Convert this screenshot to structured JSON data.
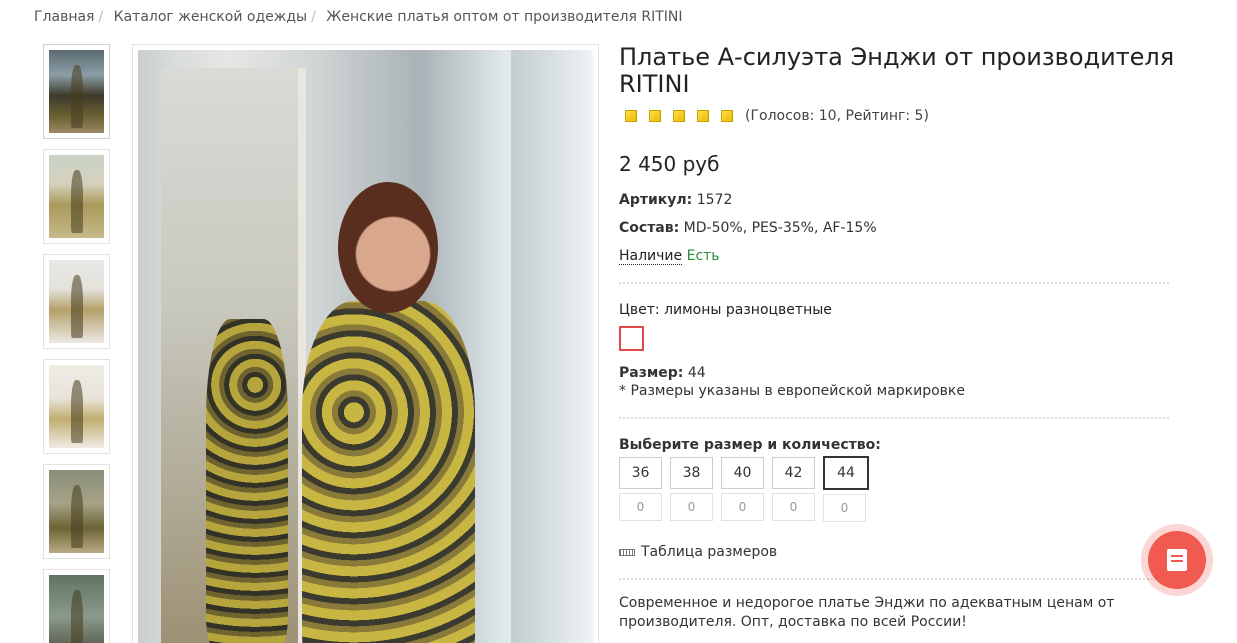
{
  "breadcrumb": {
    "items": [
      "Главная",
      "Каталог женской одежды",
      "Женские платья оптом от производителя RITINI"
    ],
    "separator": "/"
  },
  "gallery": {
    "thumb_icons": [
      "dress-photo-thumb-1",
      "dress-photo-thumb-2",
      "dress-photo-thumb-3",
      "dress-photo-thumb-4",
      "dress-photo-thumb-5",
      "dress-photo-thumb-6"
    ]
  },
  "product": {
    "title": "Платье А-силуэта Энджи от производителя RITINI",
    "rating": {
      "stars": 5,
      "text": "(Голосов: 10, Рейтинг: 5)"
    },
    "price": "2 450 руб",
    "article_label": "Артикул:",
    "article_value": "1572",
    "composition_label": "Состав:",
    "composition_value": "MD-50%, PES-35%, AF-15%",
    "availability_label": "Наличие",
    "availability_value": "Есть",
    "color_label": "Цвет:",
    "color_value": "лимоны разноцветные",
    "size_label": "Размер:",
    "size_value": "44",
    "size_note": "* Размеры указаны в европейской маркировке",
    "choose_label": "Выберите размер и количество:",
    "sizes": [
      {
        "size": "36",
        "qty": "0"
      },
      {
        "size": "38",
        "qty": "0"
      },
      {
        "size": "40",
        "qty": "0"
      },
      {
        "size": "42",
        "qty": "0"
      },
      {
        "size": "44",
        "qty": "0"
      }
    ],
    "selected_size": "44",
    "size_table_label": "Таблица размеров",
    "description": "Современное и недорогое платье Энджи по адекватным ценам от производителя. Опт, доставка по всей России!"
  },
  "colors": {
    "accent": "#f05a50",
    "available": "#2e8b3a",
    "star": "#f5c800"
  }
}
